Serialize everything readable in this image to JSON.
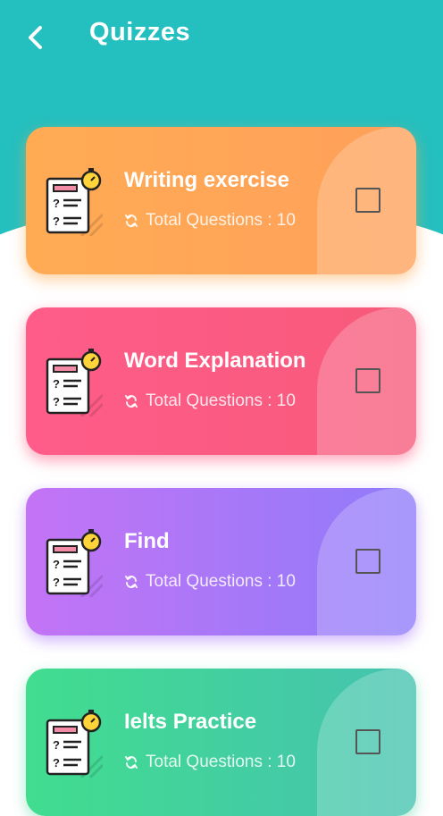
{
  "header": {
    "title": "Quizzes",
    "back_icon": "chevron-left-icon",
    "background_color": "#24bfbf"
  },
  "quizzes": [
    {
      "title": "Writing exercise",
      "meta": "Total Questions : 10",
      "color": "#ffa55a",
      "checked": false
    },
    {
      "title": "Word Explanation",
      "meta": "Total Questions : 10",
      "color": "#fb5b84",
      "checked": false
    },
    {
      "title": "Find",
      "meta": "Total Questions : 10",
      "color": "#b277f7",
      "checked": false
    },
    {
      "title": "Ielts Practice",
      "meta": "Total Questions : 10",
      "color": "#43d49a",
      "checked": false
    }
  ]
}
